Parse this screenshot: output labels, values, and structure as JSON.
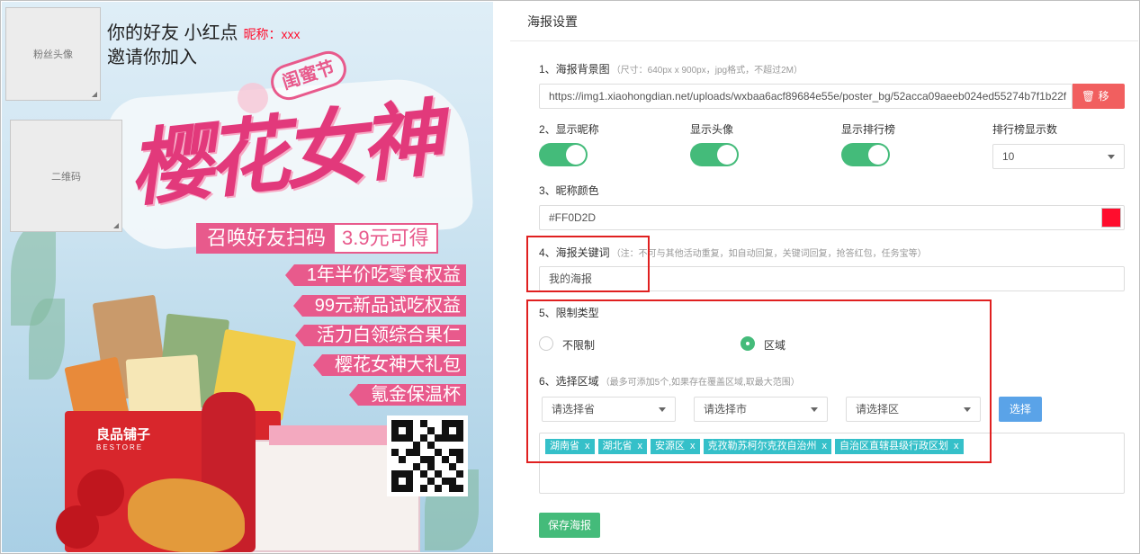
{
  "poster": {
    "fan_avatar_label": "粉丝头像",
    "qr_label": "二维码",
    "friend_text": "你的好友 小红点",
    "nickname_text": "昵称：xxx",
    "invite_text": "邀请你加入",
    "festival_tag": "闺蜜节",
    "title": "樱花女神",
    "cta_main": "召唤好友扫码",
    "cta_price": "3.9元可得",
    "benefits": [
      "1年半价吃零食权益",
      "99元新品试吃权益",
      "活力白领综合果仁",
      "樱花女神大礼包",
      "氪金保温杯"
    ],
    "brand_name": "良品铺子",
    "brand_sub": "BESTORE"
  },
  "settings": {
    "header": "海报设置",
    "bg_label": "1、海报背景图",
    "bg_hint": "（尺寸：640px x 900px，jpg格式，不超过2M）",
    "bg_url": "https://img1.xiaohongdian.net/uploads/wxbaa6acf89684e55e/poster_bg/52acca09aeeb024ed55274b7f1b22f",
    "remove_label": "移除",
    "show_nick_label": "2、显示昵称",
    "show_avatar_label": "显示头像",
    "show_rank_label": "显示排行榜",
    "rank_count_label": "排行榜显示数",
    "rank_count_value": "10",
    "nick_color_label": "3、昵称颜色",
    "nick_color_value": "#FF0D2D",
    "keyword_label": "4、海报关键词",
    "keyword_hint": "（注：不可与其他活动重复，如自动回复，关键词回复，抢答红包，任务宝等）",
    "keyword_value": "我的海报",
    "limit_label": "5、限制类型",
    "limit_none": "不限制",
    "limit_region": "区域",
    "region_label": "6、选择区域",
    "region_hint": "（最多可添加5个,如果存在覆盖区域,取最大范围）",
    "province_placeholder": "请选择省",
    "city_placeholder": "请选择市",
    "district_placeholder": "请选择区",
    "choose_label": "选择",
    "tags": [
      "湖南省",
      "湖北省",
      "安源区",
      "克孜勒苏柯尔克孜自治州",
      "自治区直辖县级行政区划"
    ],
    "tag_remove": "x",
    "save_label": "保存海报"
  },
  "colors": {
    "nickname": "#FF0D2D",
    "toggle_on": "#44bb7a",
    "remove_button": "#f15f5f",
    "choose_button": "#5aa3e8",
    "tag": "#35c0c9",
    "highlight": "#e02020"
  },
  "toggles": {
    "show_nickname": true,
    "show_avatar": true,
    "show_rank": true
  },
  "limit_type_selected": "区域"
}
